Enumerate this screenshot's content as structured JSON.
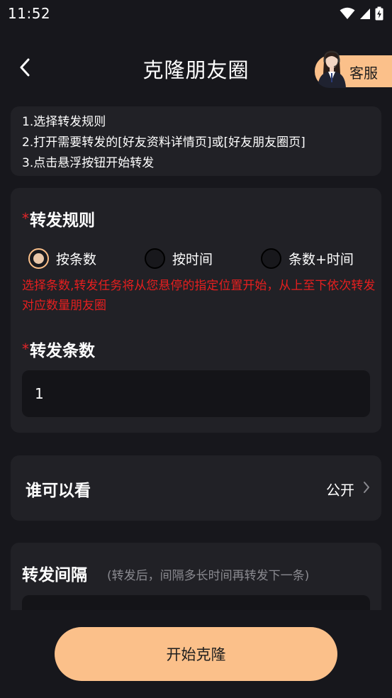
{
  "status_bar": {
    "time": "11:52"
  },
  "header": {
    "title": "克隆朋友圈",
    "service_label": "客服"
  },
  "tips": [
    "1.选择转发规则",
    "2.打开需要转发的[好友资料详情页]或[好友朋友圈页]",
    "3.点击悬浮按钮开始转发"
  ],
  "rule_section": {
    "required_mark": "*",
    "title": "转发规则",
    "options": [
      {
        "label": "按条数",
        "selected": true
      },
      {
        "label": "按时间",
        "selected": false
      },
      {
        "label": "条数+时间",
        "selected": false
      }
    ],
    "hint": "选择条数,转发任务将从您悬停的指定位置开始，从上至下依次转发对应数量朋友圈"
  },
  "count_section": {
    "required_mark": "*",
    "title": "转发条数",
    "value": "1"
  },
  "visibility": {
    "label": "谁可以看",
    "value": "公开"
  },
  "interval": {
    "title": "转发间隔",
    "hint": "(转发后，间隔多长时间再转发下一条)"
  },
  "start_button": {
    "label": "开始克隆"
  },
  "colors": {
    "background": "#17171c",
    "card": "#212126",
    "accent": "#fbc08a",
    "warning": "#e71f1f"
  }
}
